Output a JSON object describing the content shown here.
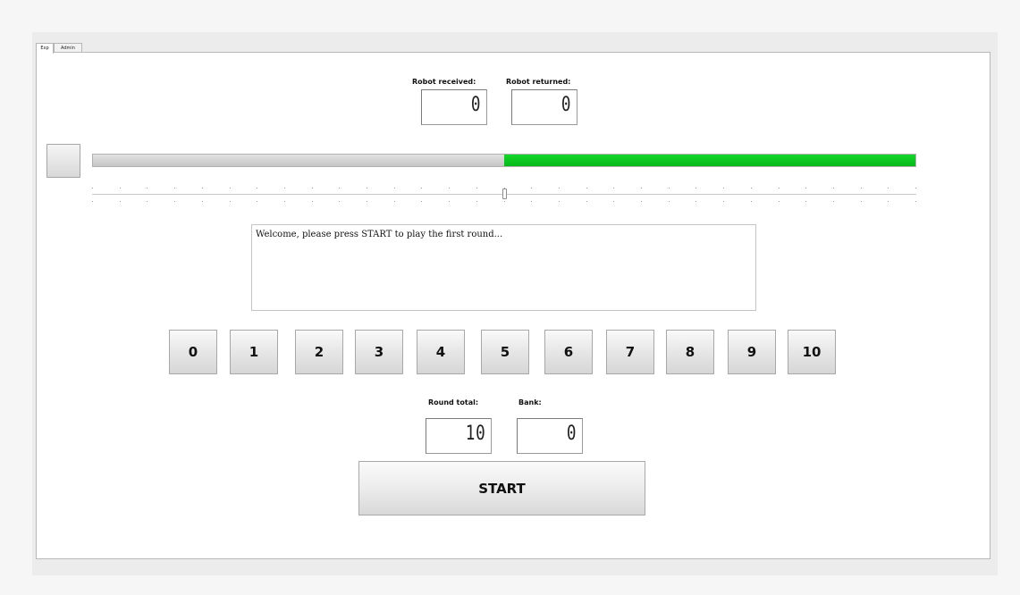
{
  "tabs": [
    "Exp",
    "Admin"
  ],
  "robot": {
    "received_label": "Robot received:",
    "received_value": "0",
    "returned_label": "Robot returned:",
    "returned_value": "0"
  },
  "progress": {
    "fraction_filled": 0.5,
    "fill_color": "#0bc423",
    "track_color": "#cccccc"
  },
  "slider": {
    "value_fraction": 0.5,
    "tick_count": 31
  },
  "message": "Welcome, please press START to play the first round...",
  "number_buttons": [
    "0",
    "1",
    "2",
    "3",
    "4",
    "5",
    "6",
    "7",
    "8",
    "9",
    "10"
  ],
  "round": {
    "total_label": "Round total:",
    "total_value": "10",
    "bank_label": "Bank:",
    "bank_value": "0"
  },
  "start_label": "START"
}
